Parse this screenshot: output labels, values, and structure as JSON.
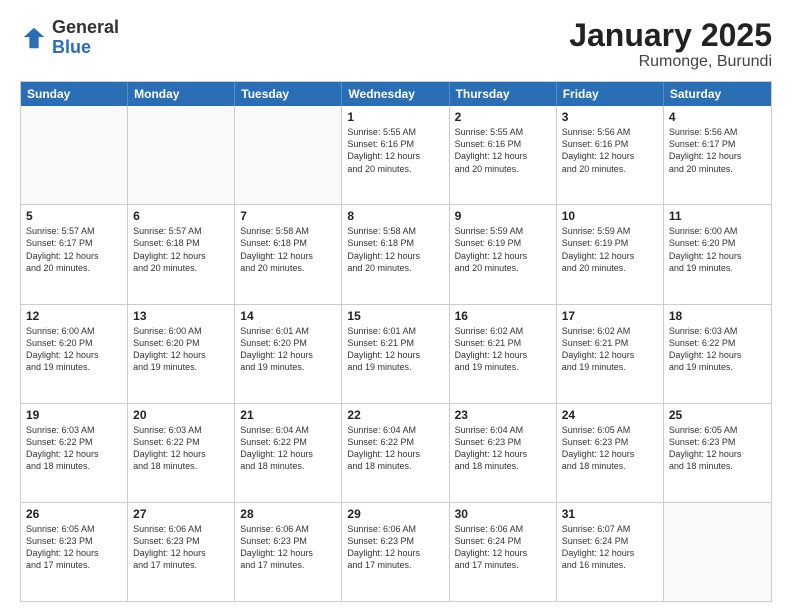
{
  "header": {
    "logo_general": "General",
    "logo_blue": "Blue",
    "month_title": "January 2025",
    "subtitle": "Rumonge, Burundi"
  },
  "weekdays": [
    "Sunday",
    "Monday",
    "Tuesday",
    "Wednesday",
    "Thursday",
    "Friday",
    "Saturday"
  ],
  "rows": [
    [
      {
        "day": "",
        "info": ""
      },
      {
        "day": "",
        "info": ""
      },
      {
        "day": "",
        "info": ""
      },
      {
        "day": "1",
        "info": "Sunrise: 5:55 AM\nSunset: 6:16 PM\nDaylight: 12 hours\nand 20 minutes."
      },
      {
        "day": "2",
        "info": "Sunrise: 5:55 AM\nSunset: 6:16 PM\nDaylight: 12 hours\nand 20 minutes."
      },
      {
        "day": "3",
        "info": "Sunrise: 5:56 AM\nSunset: 6:16 PM\nDaylight: 12 hours\nand 20 minutes."
      },
      {
        "day": "4",
        "info": "Sunrise: 5:56 AM\nSunset: 6:17 PM\nDaylight: 12 hours\nand 20 minutes."
      }
    ],
    [
      {
        "day": "5",
        "info": "Sunrise: 5:57 AM\nSunset: 6:17 PM\nDaylight: 12 hours\nand 20 minutes."
      },
      {
        "day": "6",
        "info": "Sunrise: 5:57 AM\nSunset: 6:18 PM\nDaylight: 12 hours\nand 20 minutes."
      },
      {
        "day": "7",
        "info": "Sunrise: 5:58 AM\nSunset: 6:18 PM\nDaylight: 12 hours\nand 20 minutes."
      },
      {
        "day": "8",
        "info": "Sunrise: 5:58 AM\nSunset: 6:18 PM\nDaylight: 12 hours\nand 20 minutes."
      },
      {
        "day": "9",
        "info": "Sunrise: 5:59 AM\nSunset: 6:19 PM\nDaylight: 12 hours\nand 20 minutes."
      },
      {
        "day": "10",
        "info": "Sunrise: 5:59 AM\nSunset: 6:19 PM\nDaylight: 12 hours\nand 20 minutes."
      },
      {
        "day": "11",
        "info": "Sunrise: 6:00 AM\nSunset: 6:20 PM\nDaylight: 12 hours\nand 19 minutes."
      }
    ],
    [
      {
        "day": "12",
        "info": "Sunrise: 6:00 AM\nSunset: 6:20 PM\nDaylight: 12 hours\nand 19 minutes."
      },
      {
        "day": "13",
        "info": "Sunrise: 6:00 AM\nSunset: 6:20 PM\nDaylight: 12 hours\nand 19 minutes."
      },
      {
        "day": "14",
        "info": "Sunrise: 6:01 AM\nSunset: 6:20 PM\nDaylight: 12 hours\nand 19 minutes."
      },
      {
        "day": "15",
        "info": "Sunrise: 6:01 AM\nSunset: 6:21 PM\nDaylight: 12 hours\nand 19 minutes."
      },
      {
        "day": "16",
        "info": "Sunrise: 6:02 AM\nSunset: 6:21 PM\nDaylight: 12 hours\nand 19 minutes."
      },
      {
        "day": "17",
        "info": "Sunrise: 6:02 AM\nSunset: 6:21 PM\nDaylight: 12 hours\nand 19 minutes."
      },
      {
        "day": "18",
        "info": "Sunrise: 6:03 AM\nSunset: 6:22 PM\nDaylight: 12 hours\nand 19 minutes."
      }
    ],
    [
      {
        "day": "19",
        "info": "Sunrise: 6:03 AM\nSunset: 6:22 PM\nDaylight: 12 hours\nand 18 minutes."
      },
      {
        "day": "20",
        "info": "Sunrise: 6:03 AM\nSunset: 6:22 PM\nDaylight: 12 hours\nand 18 minutes."
      },
      {
        "day": "21",
        "info": "Sunrise: 6:04 AM\nSunset: 6:22 PM\nDaylight: 12 hours\nand 18 minutes."
      },
      {
        "day": "22",
        "info": "Sunrise: 6:04 AM\nSunset: 6:22 PM\nDaylight: 12 hours\nand 18 minutes."
      },
      {
        "day": "23",
        "info": "Sunrise: 6:04 AM\nSunset: 6:23 PM\nDaylight: 12 hours\nand 18 minutes."
      },
      {
        "day": "24",
        "info": "Sunrise: 6:05 AM\nSunset: 6:23 PM\nDaylight: 12 hours\nand 18 minutes."
      },
      {
        "day": "25",
        "info": "Sunrise: 6:05 AM\nSunset: 6:23 PM\nDaylight: 12 hours\nand 18 minutes."
      }
    ],
    [
      {
        "day": "26",
        "info": "Sunrise: 6:05 AM\nSunset: 6:23 PM\nDaylight: 12 hours\nand 17 minutes."
      },
      {
        "day": "27",
        "info": "Sunrise: 6:06 AM\nSunset: 6:23 PM\nDaylight: 12 hours\nand 17 minutes."
      },
      {
        "day": "28",
        "info": "Sunrise: 6:06 AM\nSunset: 6:23 PM\nDaylight: 12 hours\nand 17 minutes."
      },
      {
        "day": "29",
        "info": "Sunrise: 6:06 AM\nSunset: 6:23 PM\nDaylight: 12 hours\nand 17 minutes."
      },
      {
        "day": "30",
        "info": "Sunrise: 6:06 AM\nSunset: 6:24 PM\nDaylight: 12 hours\nand 17 minutes."
      },
      {
        "day": "31",
        "info": "Sunrise: 6:07 AM\nSunset: 6:24 PM\nDaylight: 12 hours\nand 16 minutes."
      },
      {
        "day": "",
        "info": ""
      }
    ]
  ]
}
